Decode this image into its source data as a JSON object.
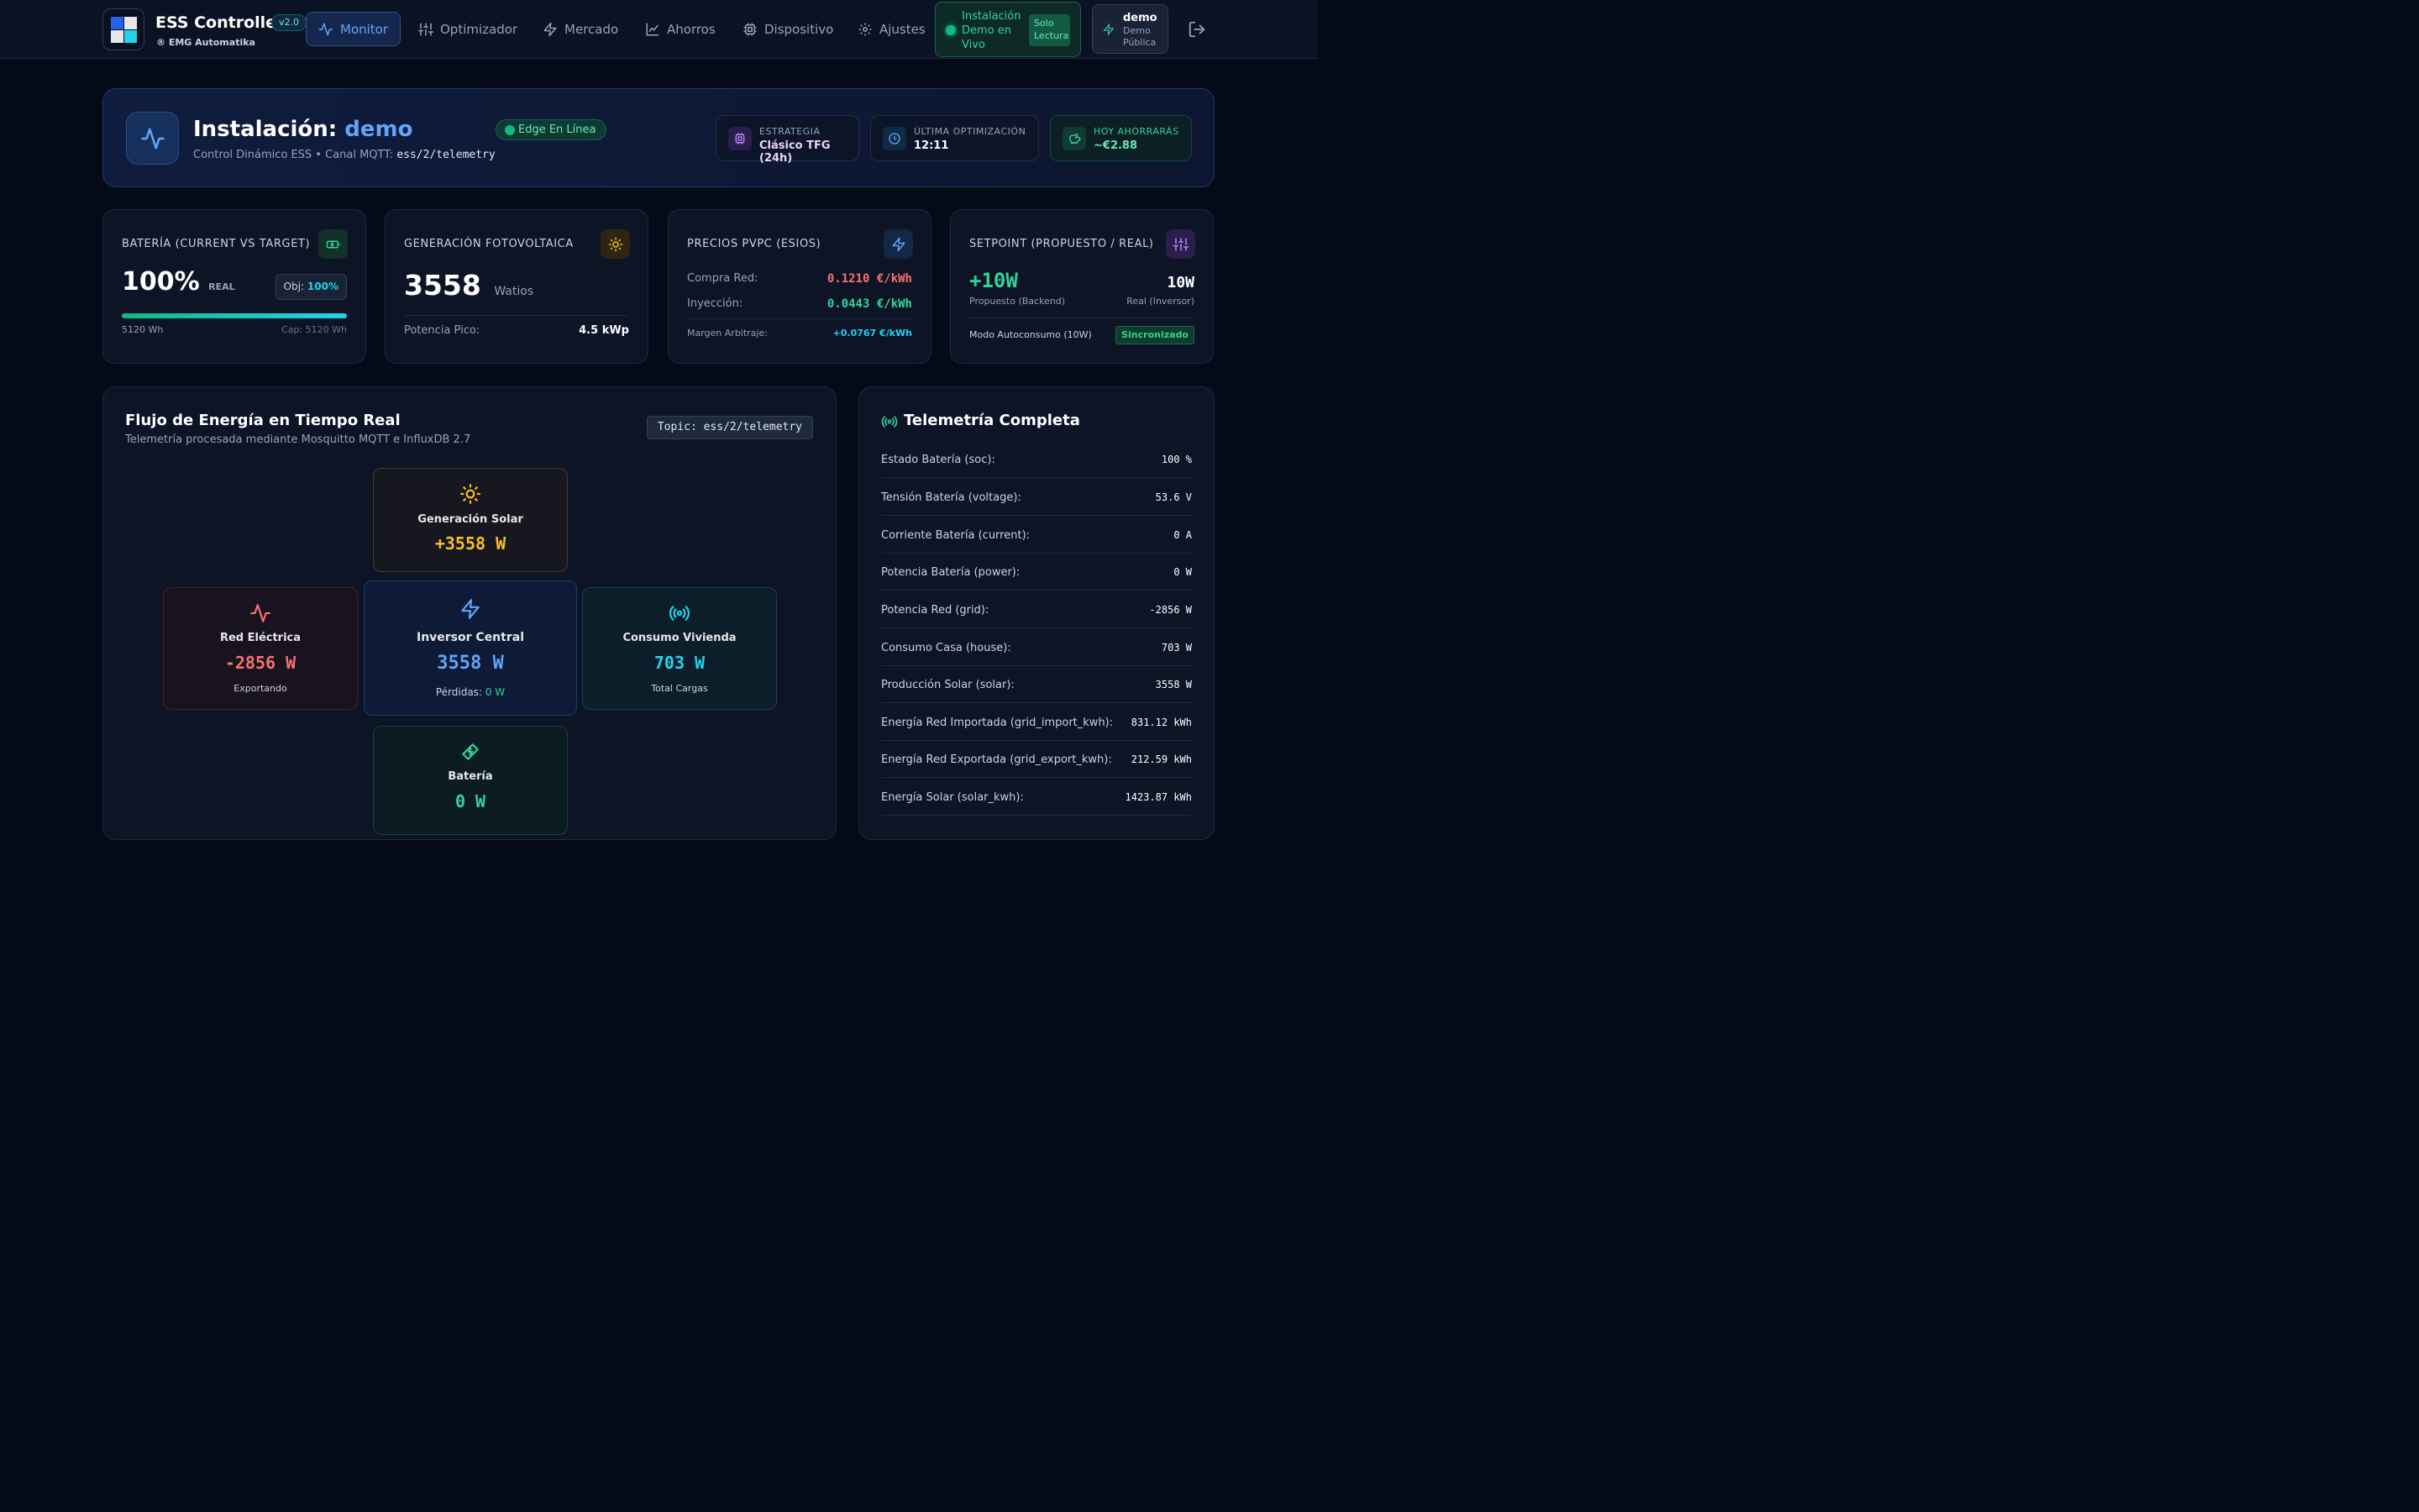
{
  "nav": {
    "brand_title": "ESS Controller",
    "version": "v2.0",
    "brand_sub": "® EMG Automatika",
    "items": [
      {
        "label": "Monitor",
        "icon": "activity-icon",
        "active": true
      },
      {
        "label": "Optimizador",
        "icon": "sliders-icon"
      },
      {
        "label": "Mercado",
        "icon": "zap-icon"
      },
      {
        "label": "Ahorros",
        "icon": "trend-chart-icon"
      },
      {
        "label": "Dispositivo",
        "icon": "cpu-icon"
      },
      {
        "label": "Ajustes",
        "icon": "gear-icon"
      }
    ],
    "demo_status": "Instalación Demo en Vivo",
    "readonly": "Solo Lectura",
    "user_name": "demo",
    "user_role": "Demo Pública"
  },
  "banner": {
    "title_prefix": "Instalación:",
    "title_highlight": "demo",
    "status": "Edge En Línea",
    "sub_text": "Control Dinámico ESS • Canal MQTT:",
    "sub_topic": "ess/2/telemetry",
    "strategy_label": "ESTRATEGIA",
    "strategy_value": "Clásico TFG (24h)",
    "last_opt_label": "ÚLTIMA OPTIMIZACIÓN",
    "last_opt_value": "12:11",
    "savings_label": "HOY AHORRARÁS",
    "savings_value": "~€2.88"
  },
  "cards": {
    "battery": {
      "title": "BATERÍA (CURRENT VS TARGET)",
      "value": "100%",
      "unit": "REAL",
      "target_label": "Obj:",
      "target_value": "100%",
      "energy": "5120 Wh",
      "capacity": "Cap: 5120 Wh",
      "progress": 100
    },
    "pv": {
      "title": "GENERACIÓN FOTOVOLTAICA",
      "value": "3558",
      "unit": "Watios",
      "peak_label": "Potencia Pico:",
      "peak_value": "4.5 kWp"
    },
    "prices": {
      "title": "PRECIOS PVPC (ESIOS)",
      "buy_label": "Compra Red:",
      "buy_value": "0.1210 €/kWh",
      "sell_label": "Inyección:",
      "sell_value": "0.0443 €/kWh",
      "margin_label": "Margen Arbitraje:",
      "margin_value": "+0.0767 €/kWh"
    },
    "setpoint": {
      "title": "SETPOINT (PROPUESTO / REAL)",
      "proposed": "+10W",
      "proposed_label": "Propuesto (Backend)",
      "real": "10W",
      "real_label": "Real (Inversor)",
      "mode": "Modo Autoconsumo (10W)",
      "sync": "Sincronizado"
    }
  },
  "flow": {
    "title": "Flujo de Energía en Tiempo Real",
    "subtitle": "Telemetría procesada mediante Mosquitto MQTT e InfluxDB 2.7",
    "topic": "Topic: ess/2/telemetry",
    "solar": {
      "label": "Generación Solar",
      "value": "+3558 W"
    },
    "grid": {
      "label": "Red Eléctrica",
      "value": "-2856 W",
      "sub": "Exportando"
    },
    "inverter": {
      "label": "Inversor Central",
      "value": "3558 W",
      "sub_label": "Pérdidas:",
      "sub_value": "0 W"
    },
    "house": {
      "label": "Consumo Vivienda",
      "value": "703 W",
      "sub": "Total Cargas"
    },
    "battery": {
      "label": "Batería",
      "value": "0 W"
    }
  },
  "telemetry": {
    "title": "Telemetría Completa",
    "rows": [
      {
        "k": "Estado Batería (soc):",
        "v": "100 %"
      },
      {
        "k": "Tensión Batería (voltage):",
        "v": "53.6 V"
      },
      {
        "k": "Corriente Batería (current):",
        "v": "0 A"
      },
      {
        "k": "Potencia Batería (power):",
        "v": "0 W"
      },
      {
        "k": "Potencia Red (grid):",
        "v": "-2856 W"
      },
      {
        "k": "Consumo Casa (house):",
        "v": "703 W"
      },
      {
        "k": "Producción Solar (solar):",
        "v": "3558 W"
      },
      {
        "k": "Energía Red Importada (grid_import_kwh):",
        "v": "831.12 kWh"
      },
      {
        "k": "Energía Red Exportada (grid_export_kwh):",
        "v": "212.59 kWh"
      },
      {
        "k": "Energía Solar (solar_kwh):",
        "v": "1423.87 kWh"
      }
    ]
  },
  "colors": {
    "accent": "#60a5fa",
    "success": "#34d399",
    "danger": "#f87171",
    "solar": "#fbbf24",
    "cyan": "#22d3ee"
  }
}
